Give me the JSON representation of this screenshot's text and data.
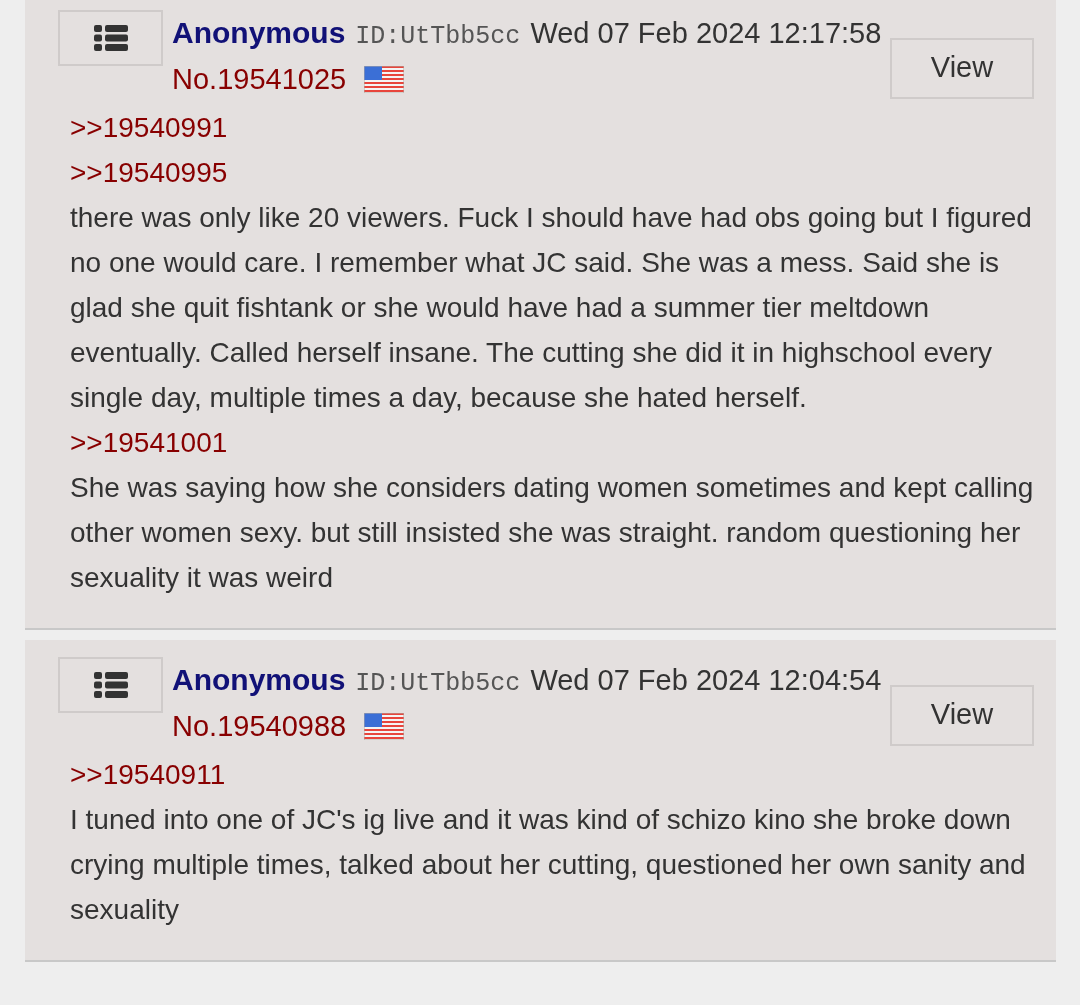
{
  "posts": [
    {
      "name": "Anonymous",
      "id": "ID:UtTbb5cc",
      "date": "Wed 07 Feb 2024 12:17:58",
      "number": "No.19541025",
      "view_button": "View",
      "body": [
        {
          "kind": "quote",
          "text": ">>19540991"
        },
        {
          "kind": "quote",
          "text": ">>19540995"
        },
        {
          "kind": "text",
          "text": "there was only like 20 viewers. Fuck I should have had obs going but I figured no one would care. I remember what JC said. She was a mess. Said she is glad she quit fishtank or she would have had a summer tier meltdown eventually. Called herself insane. The cutting she did it in highschool every single day, multiple times a day, because she hated herself."
        },
        {
          "kind": "quote",
          "text": ">>19541001"
        },
        {
          "kind": "text",
          "text": "She was saying how she considers dating women sometimes and kept calling other women sexy. but still insisted she was straight. random questioning her sexuality it was weird"
        }
      ]
    },
    {
      "name": "Anonymous",
      "id": "ID:UtTbb5cc",
      "date": "Wed 07 Feb 2024 12:04:54",
      "number": "No.19540988",
      "view_button": "View",
      "body": [
        {
          "kind": "quote",
          "text": ">>19540911"
        },
        {
          "kind": "text",
          "text": "I tuned into one of JC's ig live and it was kind of schizo kino she broke down crying multiple times, talked about her cutting, questioned her own sanity and sexuality"
        }
      ]
    }
  ]
}
